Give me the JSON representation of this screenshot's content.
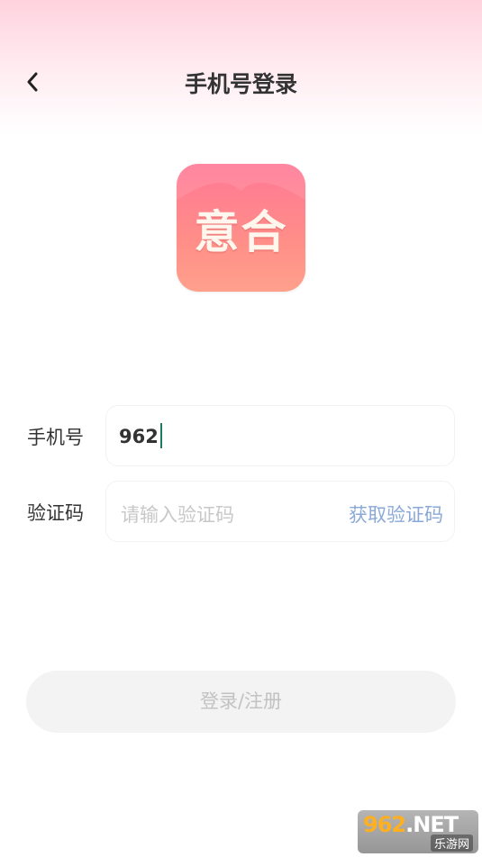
{
  "header": {
    "title": "手机号登录",
    "back_icon": "chevron-left-icon"
  },
  "logo": {
    "text": "意合",
    "gradient_top": "#ff7896",
    "gradient_bottom": "#ffa08c"
  },
  "form": {
    "phone": {
      "label": "手机号",
      "value": "962"
    },
    "code": {
      "label": "验证码",
      "placeholder": "请输入验证码",
      "get_code_label": "获取验证码"
    }
  },
  "submit": {
    "label": "登录/注册"
  },
  "watermark": {
    "main_prefix": "962",
    "main_suffix": ".NET",
    "sub": "乐游网"
  },
  "colors": {
    "accent_link": "#8aa9d8",
    "caret": "#1a7a66",
    "top_gradient": "#ffd3de",
    "disabled_button_bg": "#f3f3f3"
  }
}
